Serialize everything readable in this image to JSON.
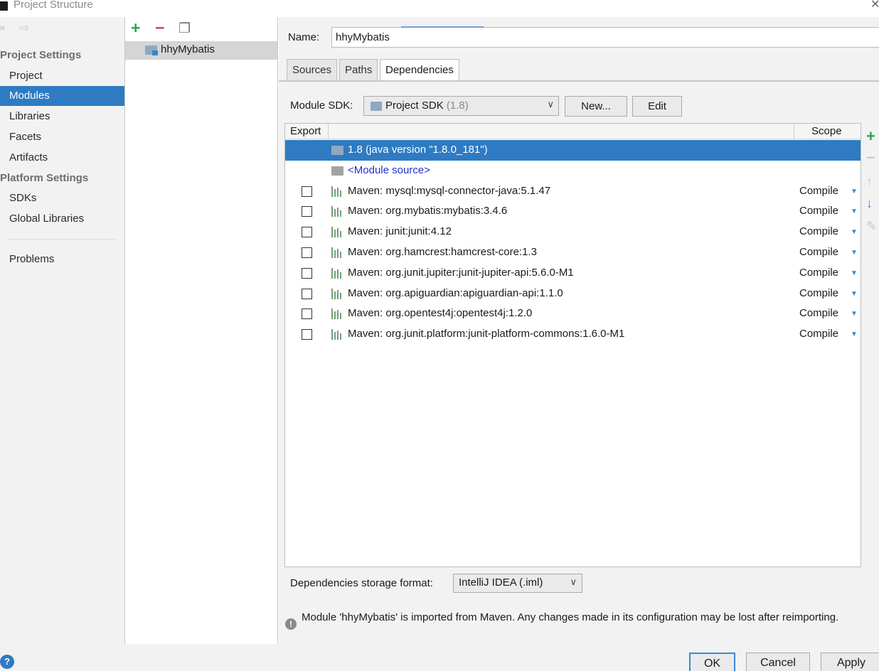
{
  "window": {
    "title": "Project Structure",
    "close_glyph": "✕"
  },
  "nav": {
    "back_glyph": "⇨",
    "forward_glyph": "⇨",
    "project_settings_heading": "Project Settings",
    "project_settings_items": [
      "Project",
      "Modules",
      "Libraries",
      "Facets",
      "Artifacts"
    ],
    "platform_settings_heading": "Platform Settings",
    "platform_settings_items": [
      "SDKs",
      "Global Libraries"
    ],
    "problems": "Problems",
    "selected": "Modules"
  },
  "module_panel": {
    "add_glyph": "+",
    "remove_glyph": "−",
    "copy_glyph": "❐",
    "module_name": "hhyMybatis"
  },
  "module": {
    "name_label": "Name:",
    "name_value": "hhyMybatis",
    "tabs": [
      "Sources",
      "Paths",
      "Dependencies"
    ],
    "active_tab": "Dependencies",
    "sdk_label": "Module SDK:",
    "sdk_value": "Project SDK",
    "sdk_version": "(1.8)",
    "new_button": "New...",
    "edit_button": "Edit",
    "table": {
      "col_export": "Export",
      "col_scope": "Scope",
      "rows": [
        {
          "name": "1.8 (java version \"1.8.0_181\")",
          "kind": "sdk",
          "selected": true,
          "scope": ""
        },
        {
          "name": "<Module source>",
          "kind": "source",
          "selected": false,
          "scope": ""
        },
        {
          "name": "Maven: mysql:mysql-connector-java:5.1.47",
          "kind": "maven",
          "selected": false,
          "scope": "Compile"
        },
        {
          "name": "Maven: org.mybatis:mybatis:3.4.6",
          "kind": "maven",
          "selected": false,
          "scope": "Compile"
        },
        {
          "name": "Maven: junit:junit:4.12",
          "kind": "maven",
          "selected": false,
          "scope": "Compile"
        },
        {
          "name": "Maven: org.hamcrest:hamcrest-core:1.3",
          "kind": "maven",
          "selected": false,
          "scope": "Compile"
        },
        {
          "name": "Maven: org.junit.jupiter:junit-jupiter-api:5.6.0-M1",
          "kind": "maven",
          "selected": false,
          "scope": "Compile"
        },
        {
          "name": "Maven: org.apiguardian:apiguardian-api:1.1.0",
          "kind": "maven",
          "selected": false,
          "scope": "Compile"
        },
        {
          "name": "Maven: org.opentest4j:opentest4j:1.2.0",
          "kind": "maven",
          "selected": false,
          "scope": "Compile"
        },
        {
          "name": "Maven: org.junit.platform:junit-platform-commons:1.6.0-M1",
          "kind": "maven",
          "selected": false,
          "scope": "Compile"
        }
      ]
    },
    "side_toolbar": {
      "add_glyph": "+",
      "remove_glyph": "−",
      "up_glyph": "↑",
      "down_glyph": "↓",
      "edit_glyph": "✎"
    },
    "storage_label": "Dependencies storage format:",
    "storage_value": "IntelliJ IDEA (.iml)",
    "warning_glyph": "!",
    "warning": "Module 'hhyMybatis' is imported from Maven. Any changes made in its configuration may be lost after reimporting."
  },
  "footer": {
    "help_glyph": "?",
    "ok": "OK",
    "cancel": "Cancel",
    "apply": "Apply"
  },
  "colors": {
    "accent": "#2e7bc3",
    "add": "#2da44e",
    "remove": "#d8453c",
    "link": "#2032c8",
    "dropdown_arrow": "#3a8ad1"
  },
  "icons": {
    "nav_back": "arrow-left-icon",
    "nav_forward": "arrow-right-icon",
    "module_folder": "module-folder-icon",
    "maven": "maven-library-icon",
    "warning": "warning-icon",
    "help": "help-icon"
  }
}
